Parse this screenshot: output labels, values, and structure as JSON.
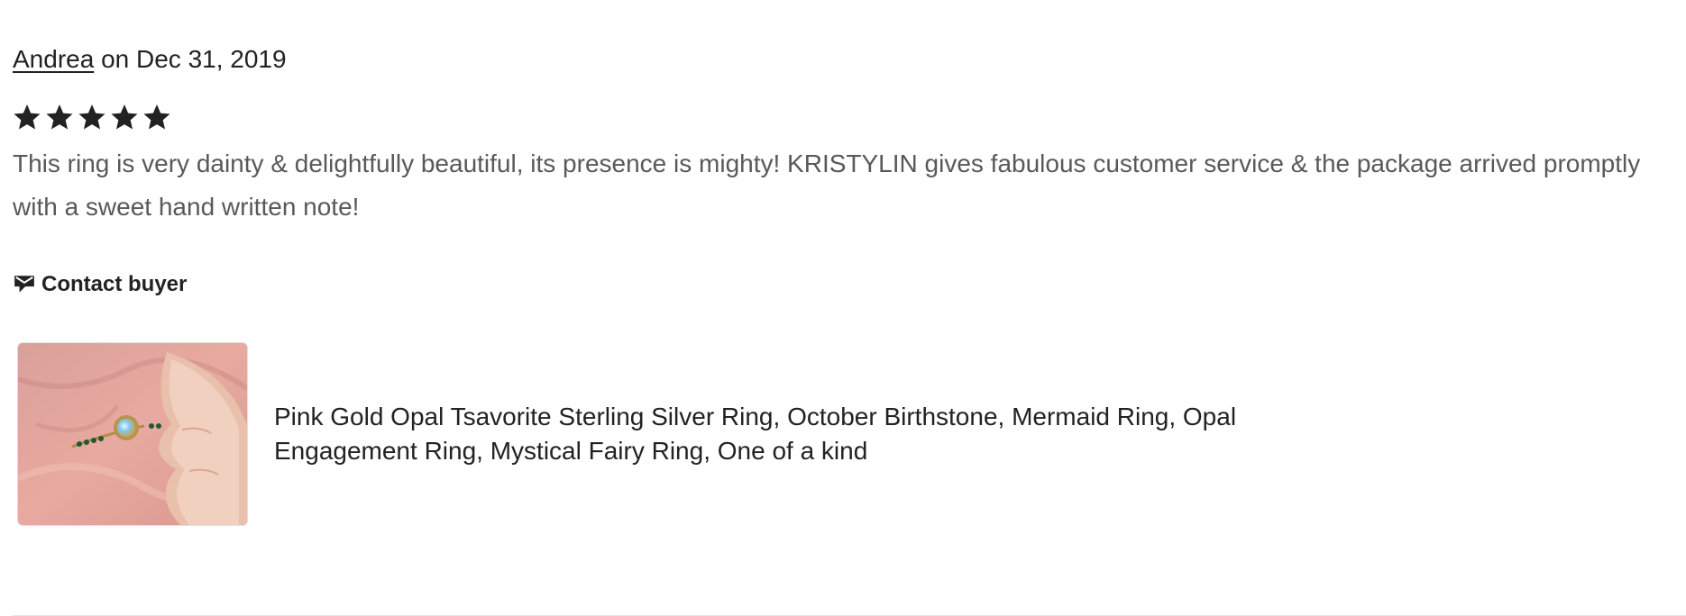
{
  "review": {
    "author": "Andrea",
    "date_text": "on Dec 31, 2019",
    "rating": 5,
    "rating_max": 5,
    "text": "This ring is very dainty & delightfully beautiful, its presence is mighty! KRISTYLIN gives fabulous customer service & the package arrived promptly with a sweet hand written note!",
    "contact_label": "Contact buyer",
    "contact_icon": "message-icon",
    "star_icon": "star-icon"
  },
  "listing": {
    "title": "Pink Gold Opal Tsavorite Sterling Silver Ring, October Birthstone, Mermaid Ring, Opal Engagement Ring, Mystical Fairy Ring, One of a kind"
  },
  "colors": {
    "text": "#222222",
    "body_text": "#595959",
    "background": "#ffffff"
  }
}
